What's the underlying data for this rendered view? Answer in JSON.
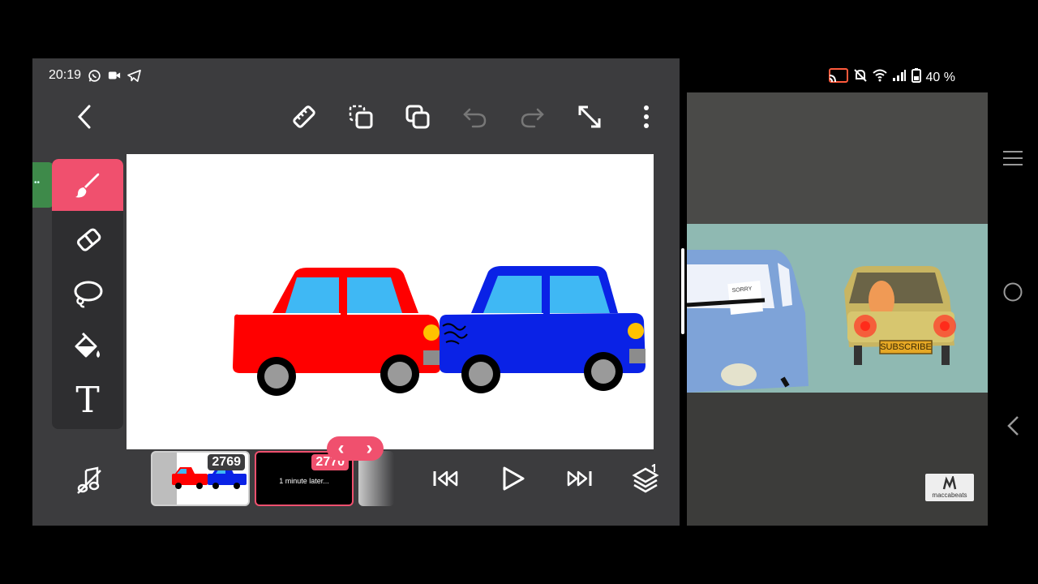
{
  "status_bar": {
    "time": "20:19",
    "icons": [
      "whatsapp-icon",
      "video-camera-icon",
      "telegram-icon"
    ],
    "right_icons": [
      "cast-icon",
      "mute-icon",
      "wifi-icon",
      "signal-icon",
      "battery-icon"
    ],
    "battery": "40 %"
  },
  "toolbar": {
    "icons": [
      "back-icon",
      "ruler-icon",
      "copy-layer-icon",
      "layers-icon",
      "undo-icon",
      "redo-icon",
      "expand-icon",
      "more-icon"
    ]
  },
  "tools": {
    "items": [
      "brush-tool",
      "eraser-tool",
      "lasso-tool",
      "fill-tool",
      "text-tool"
    ],
    "active": "brush-tool",
    "text_glyph": "T"
  },
  "timeline": {
    "frames": [
      {
        "number": "2769",
        "label": ""
      },
      {
        "number": "2770",
        "label": "1 minute later..."
      }
    ],
    "nav_prev": "‹",
    "nav_next": "›"
  },
  "video": {
    "plate_text": "SUBSCRIBE",
    "note_text": "SORRY",
    "logo_text": "maccabeats"
  },
  "colors": {
    "accent": "#f0506e",
    "panel": "#3c3c3e",
    "red_car": "#ff0000",
    "blue_car": "#0a22e6"
  }
}
